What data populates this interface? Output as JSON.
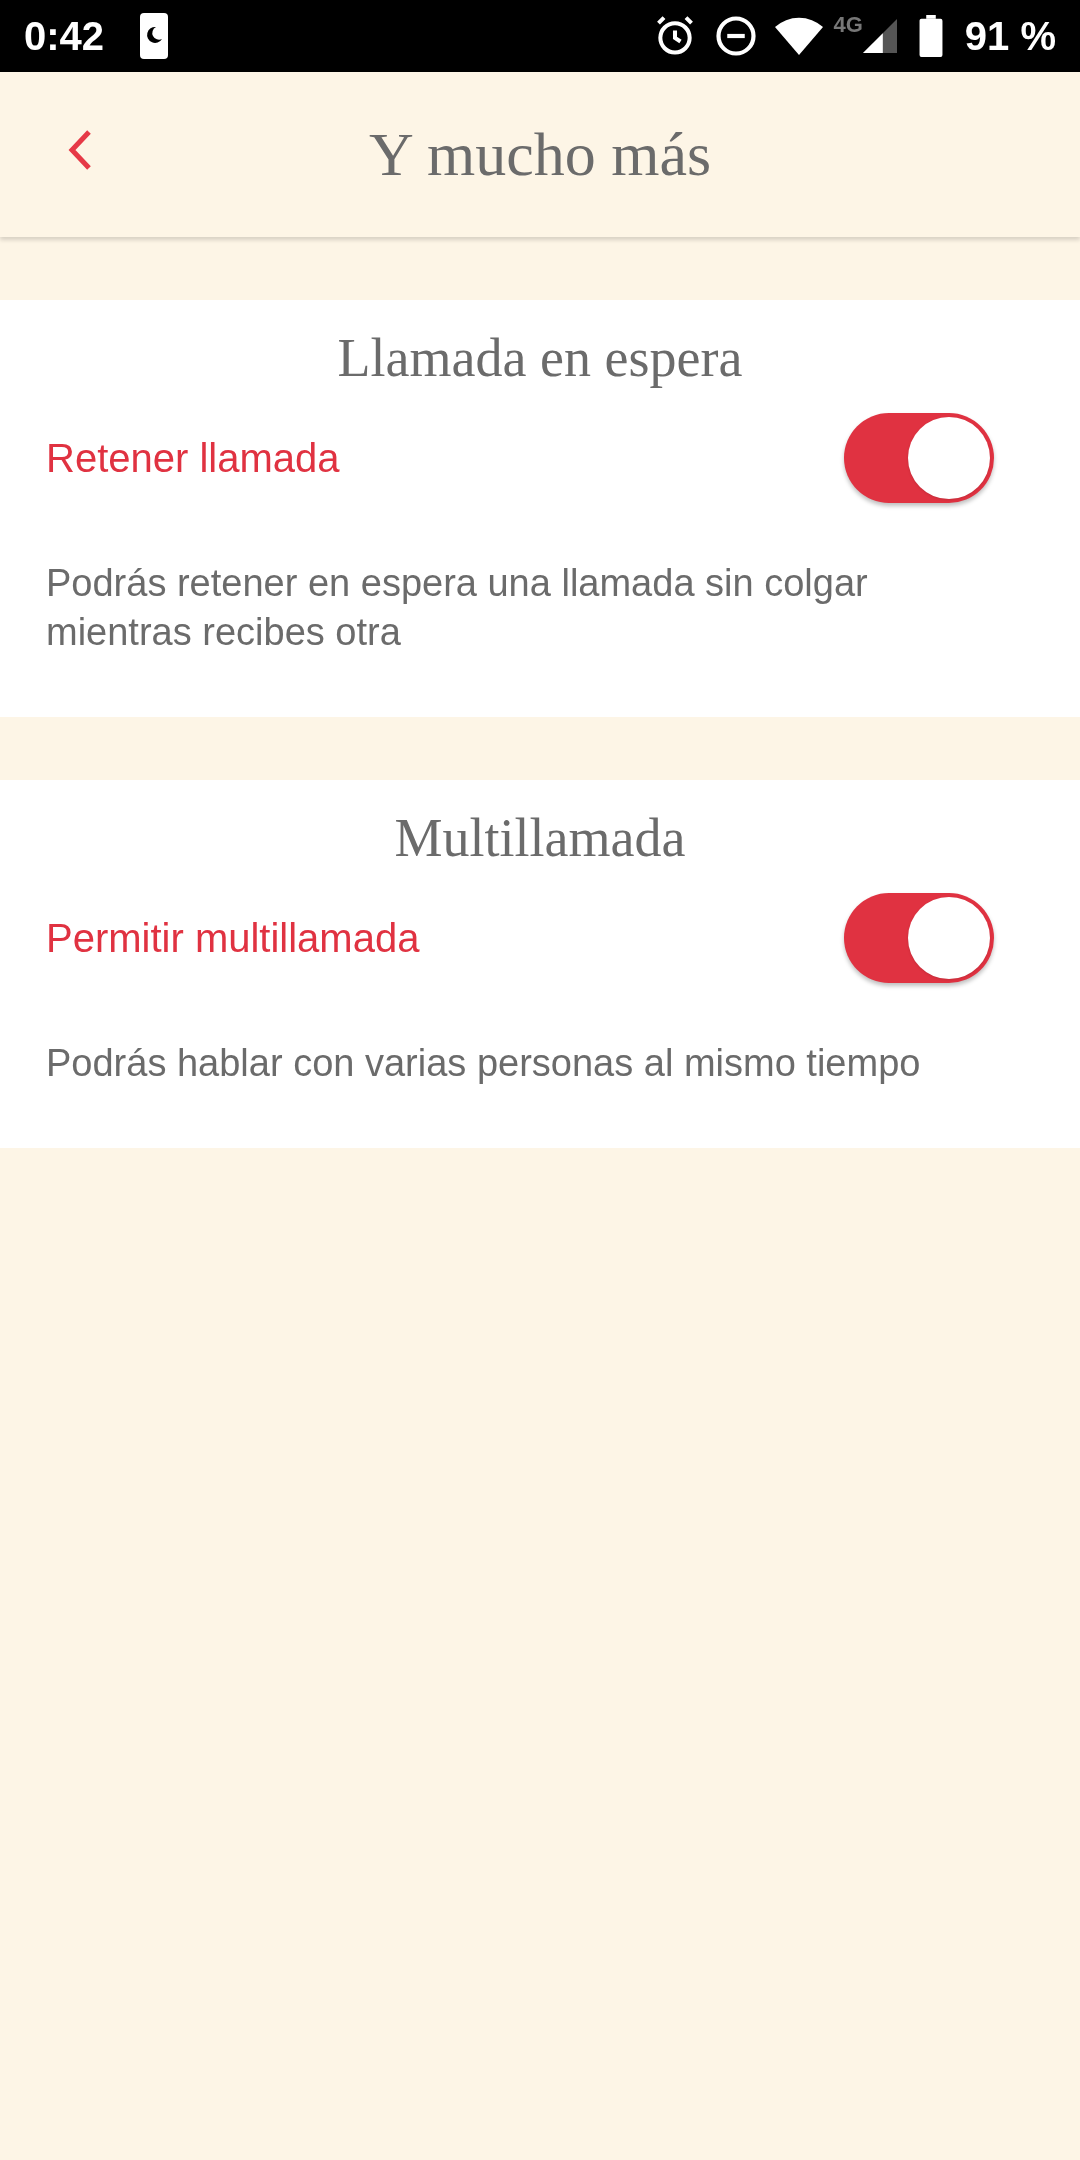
{
  "status_bar": {
    "time": "0:42",
    "network": "4G",
    "battery": "91 %"
  },
  "header": {
    "title": "Y mucho más"
  },
  "sections": [
    {
      "title": "Llamada en espera",
      "setting": {
        "label": "Retener llamada",
        "on": true
      },
      "description": "Podrás retener en espera una llamada sin colgar mientras recibes otra"
    },
    {
      "title": "Multillamada",
      "setting": {
        "label": "Permitir multillamada",
        "on": true
      },
      "description": "Podrás hablar con varias personas al mismo tiempo"
    }
  ]
}
